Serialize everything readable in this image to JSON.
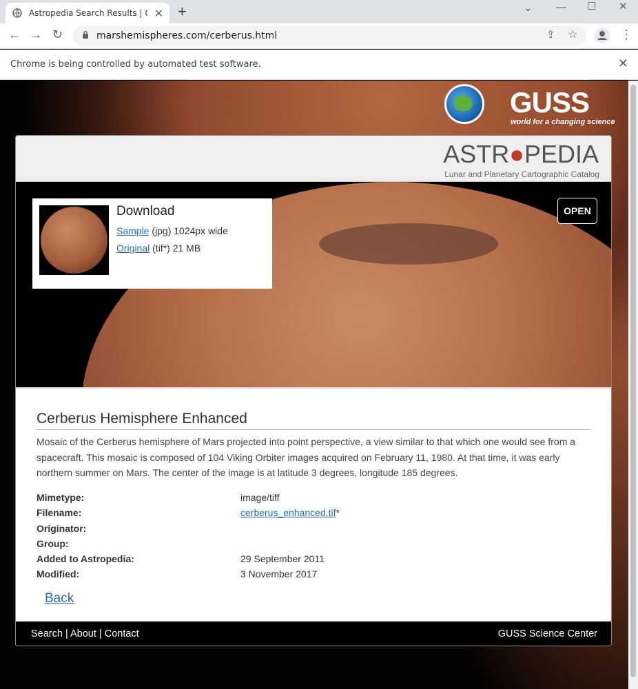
{
  "browser": {
    "tab_title": "Astropedia Search Results | GUSS",
    "url": "marshemispheres.com/cerberus.html",
    "info_text": "Chrome is being controlled by automated test software."
  },
  "header": {
    "agency_logo": "GUSS",
    "agency_tagline": "world for a changing science",
    "catalog_name_part1": "ASTR",
    "catalog_name_part2": "PEDIA",
    "catalog_subtitle": "Lunar and Planetary Cartographic Catalog"
  },
  "download": {
    "heading": "Download",
    "sample_link": "Sample",
    "sample_info": " (jpg) 1024px wide",
    "original_link": "Original",
    "original_info": " (tif*) 21 MB",
    "open_label": "OPEN"
  },
  "product": {
    "title": "Cerberus Hemisphere Enhanced",
    "description": "Mosaic of the Cerberus hemisphere of Mars projected into point perspective, a view similar to that which one would see from a spacecraft. This mosaic is composed of 104 Viking Orbiter images acquired on February 11, 1980. At that time, it was early northern summer on Mars. The center of the image is at latitude 3 degrees, longitude 185 degrees.",
    "metadata": [
      {
        "key": "Mimetype:",
        "value": "image/tiff"
      },
      {
        "key": "Filename:",
        "value": "cerberus_enhanced.tif",
        "suffix": "*"
      },
      {
        "key": "Originator:",
        "value": ""
      },
      {
        "key": "Group:",
        "value": ""
      },
      {
        "key": "Added to Astropedia:",
        "value": "29 September 2011"
      },
      {
        "key": "Modified:",
        "value": "3 November 2017"
      }
    ],
    "back_label": "Back"
  },
  "footer": {
    "search": "Search",
    "about": "About",
    "contact": "Contact",
    "sep": " | ",
    "right_text": "GUSS Science Center"
  },
  "icons": {
    "tab_favicon": "globe-icon",
    "nav_back": "arrow-left-icon",
    "nav_forward": "arrow-right-icon",
    "reload": "reload-icon",
    "lock": "lock-icon",
    "share": "share-icon",
    "bookmark": "star-icon",
    "profile": "profile-icon",
    "menu": "kebab-menu-icon"
  },
  "colors": {
    "link": "#2a6cad",
    "accent_red": "#c0392b"
  }
}
